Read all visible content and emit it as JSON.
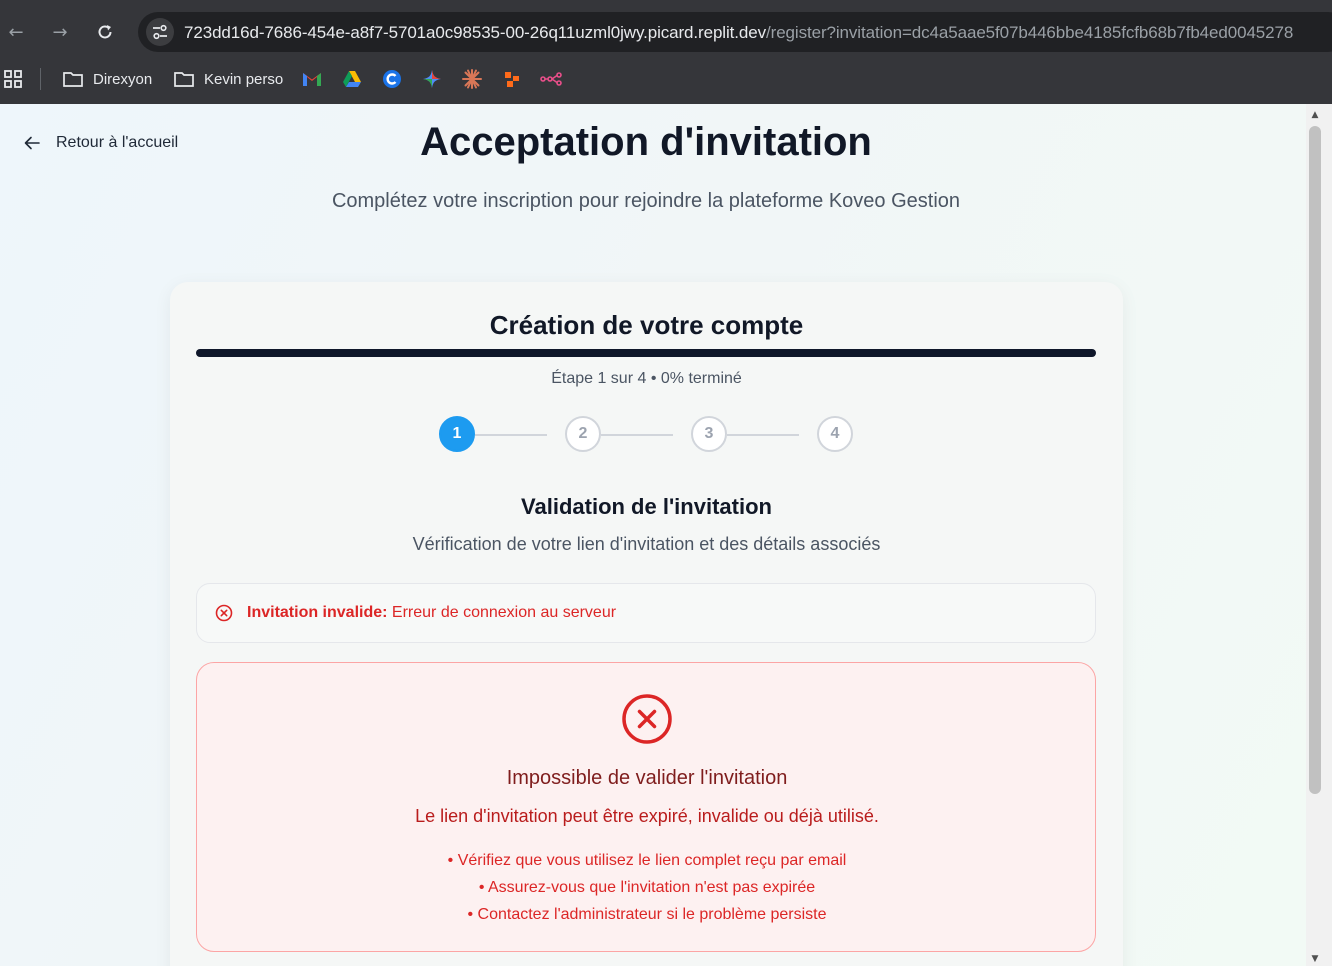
{
  "browser": {
    "url_host": "723dd16d-7686-454e-a8f7-5701a0c98535-00-26q11uzml0jwy.picard.replit.dev",
    "url_rest": "/register?invitation=dc4a5aae5f07b446bbe4185fcfb68b7fb4ed0045278",
    "bookmarks": [
      {
        "label": "Direxyon",
        "icon": "folder-icon"
      },
      {
        "label": "Kevin perso",
        "icon": "folder-icon"
      }
    ],
    "bookmark_icons": [
      "gmail-icon",
      "google-drive-icon",
      "c-app-icon",
      "gemini-icon",
      "claude-icon",
      "zapier-icon",
      "workflow-icon"
    ]
  },
  "page": {
    "back_label": "Retour à l'accueil",
    "title": "Acceptation d'invitation",
    "subtitle": "Complétez votre inscription pour rejoindre la plateforme Koveo Gestion"
  },
  "card": {
    "title": "Création de votre compte",
    "progress_percent": 0,
    "step_text": "Étape 1 sur 4 • 0% terminé",
    "steps": [
      "1",
      "2",
      "3",
      "4"
    ],
    "active_step": 1,
    "section_title": "Validation de l'invitation",
    "section_subtitle": "Vérification de votre lien d'invitation et des détails associés",
    "alert": {
      "label": "Invitation invalide:",
      "message": "Erreur de connexion au serveur"
    },
    "error": {
      "title": "Impossible de valider l'invitation",
      "description": "Le lien d'invitation peut être expiré, invalide ou déjà utilisé.",
      "tips": [
        "• Vérifiez que vous utilisez le lien complet reçu par email",
        "• Assurez-vous que l'invitation n'est pas expirée",
        "• Contactez l'administrateur si le problème persiste"
      ]
    }
  },
  "colors": {
    "accent": "#1d9bf0",
    "error": "#dc2626"
  }
}
